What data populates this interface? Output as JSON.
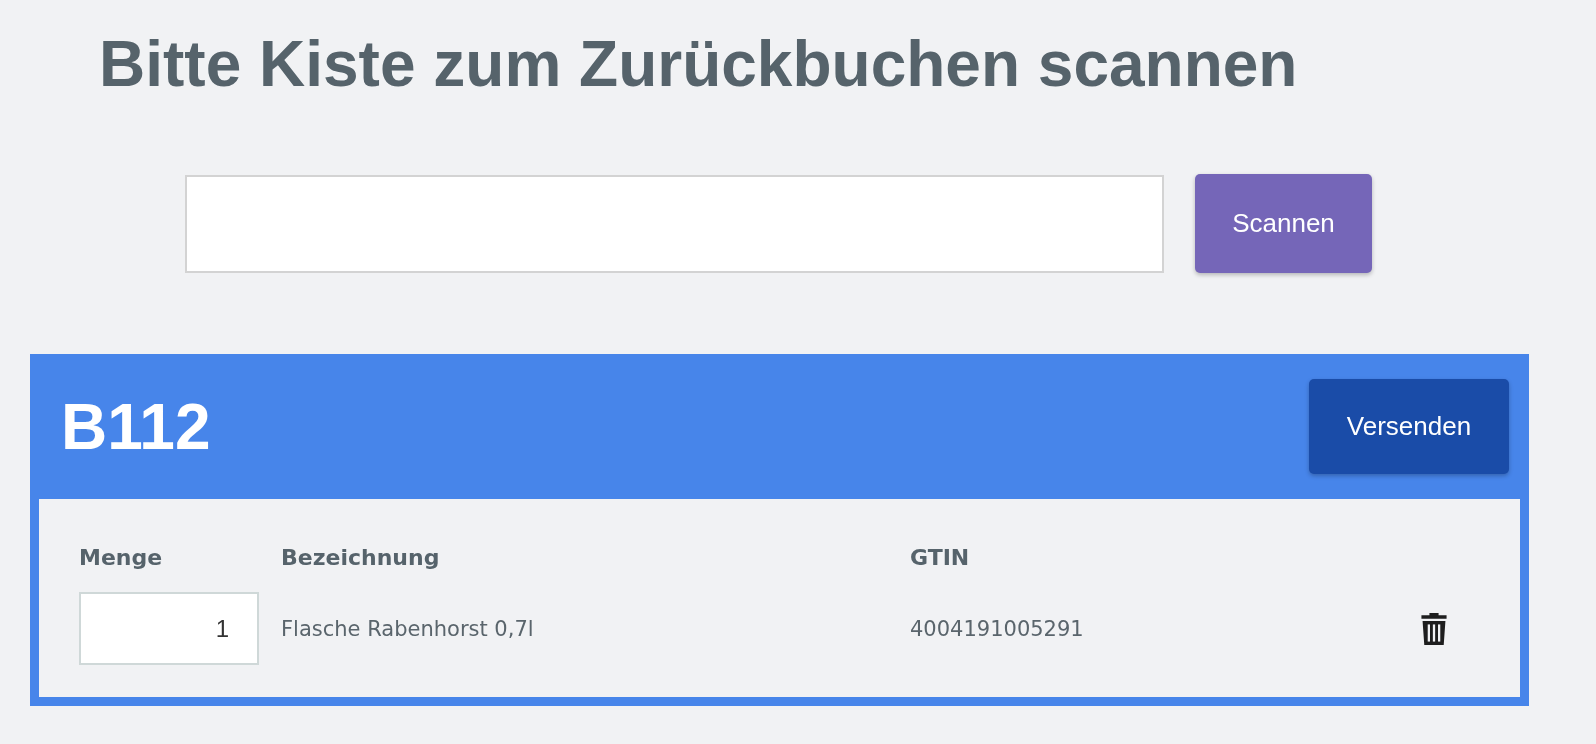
{
  "title": "Bitte Kiste zum Zurückbuchen scannen",
  "scan_button": "Scannen",
  "box": {
    "name": "B112",
    "send_button": "Versenden",
    "columns": [
      "Menge",
      "Bezeichnung",
      "GTIN"
    ],
    "rows": [
      {
        "quantity": "1",
        "description": "Flasche Rabenhorst 0,7l",
        "gtin": "4004191005291"
      }
    ]
  }
}
